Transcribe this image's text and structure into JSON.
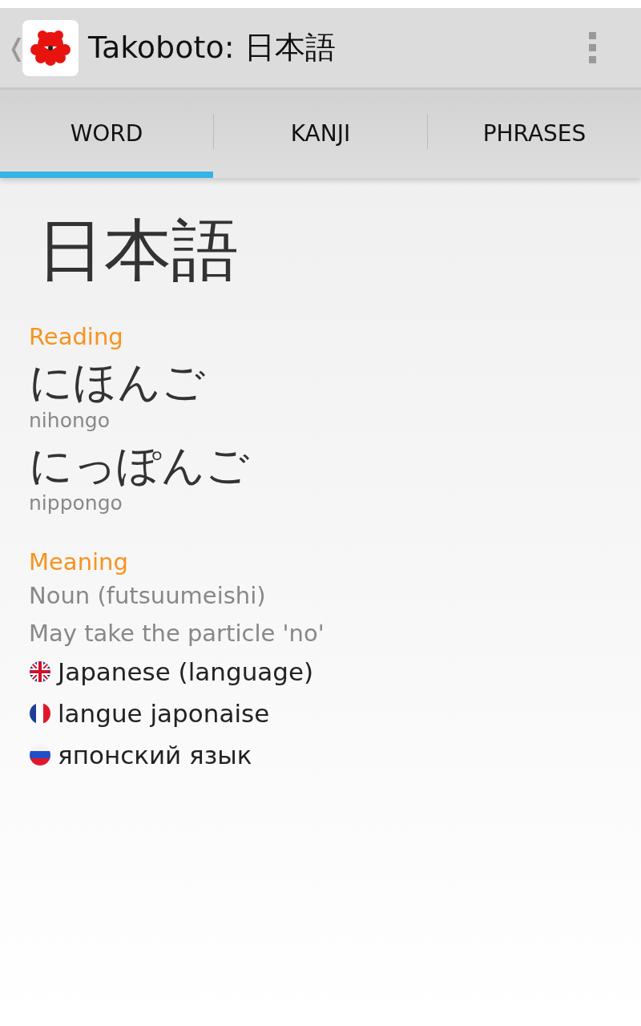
{
  "action_bar": {
    "back": "❬",
    "title": "Takoboto: 日本語"
  },
  "tabs": [
    {
      "label": "WORD",
      "selected": true
    },
    {
      "label": "KANJI",
      "selected": false
    },
    {
      "label": "PHRASES",
      "selected": false
    }
  ],
  "word": "日本語",
  "reading": {
    "heading": "Reading",
    "readings": [
      {
        "kana": "にほんご",
        "romaji": "nihongo"
      },
      {
        "kana": "にっぽんご",
        "romaji": "nippongo"
      }
    ]
  },
  "meaning": {
    "heading": "Meaning",
    "notes": [
      "Noun (futsuumeishi)",
      "May take the particle 'no'"
    ],
    "translations": [
      {
        "kind": "en",
        "text": "Japanese (language)"
      },
      {
        "kind": "fr",
        "text": "langue japonaise"
      },
      {
        "kind": "ru",
        "text": "японский язык"
      }
    ]
  }
}
